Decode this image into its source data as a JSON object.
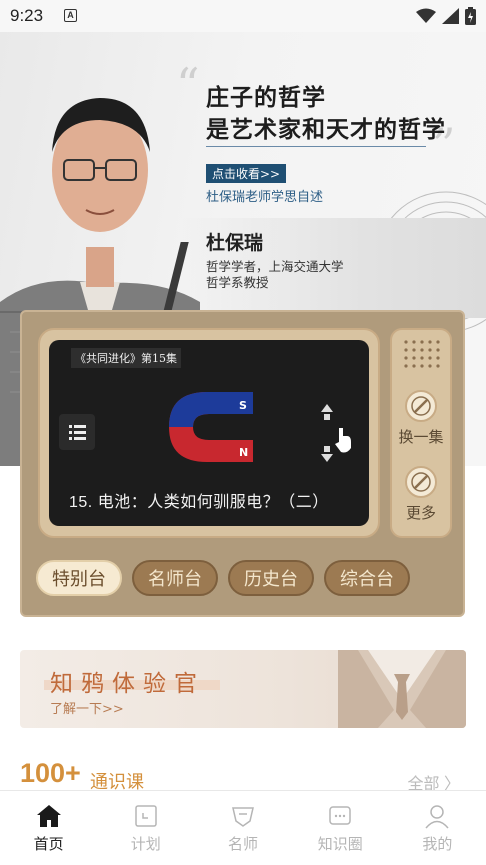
{
  "status_bar": {
    "time": "9:23",
    "notification_icon": "A"
  },
  "hero": {
    "title_line1": "庄子的哲学",
    "title_line2": "是艺术家和天才的哲学",
    "watch_button": "点击收看>>",
    "subtitle": "杜保瑞老师学思自述",
    "teacher_name": "杜保瑞",
    "teacher_desc_line1": "哲学学者，上海交通大学",
    "teacher_desc_line2": "哲学系教授"
  },
  "tv": {
    "episode_tag": "《共同进化》第15集",
    "episode_title": "15. 电池：人类如何驯服电？（二）",
    "switch_label": "换一集",
    "more_label": "更多",
    "channels": [
      {
        "label": "特别台",
        "active": true
      },
      {
        "label": "名师台",
        "active": false
      },
      {
        "label": "历史台",
        "active": false
      },
      {
        "label": "综合台",
        "active": false
      }
    ]
  },
  "promo": {
    "title": "知鸦体验官",
    "link": "了解一下>>"
  },
  "courses": {
    "count": "100+",
    "label": "通识课",
    "all_link": "全部 〉"
  },
  "bottom_nav": [
    {
      "label": "首页",
      "icon": "home-icon",
      "active": true
    },
    {
      "label": "计划",
      "icon": "calendar-icon",
      "active": false
    },
    {
      "label": "名师",
      "icon": "teacher-icon",
      "active": false
    },
    {
      "label": "知识圈",
      "icon": "circle-chat-icon",
      "active": false
    },
    {
      "label": "我的",
      "icon": "profile-icon",
      "active": false
    }
  ],
  "colors": {
    "accent": "#d4903c",
    "tv_body": "#b09b7c",
    "brand_blue": "#1f4f73"
  }
}
